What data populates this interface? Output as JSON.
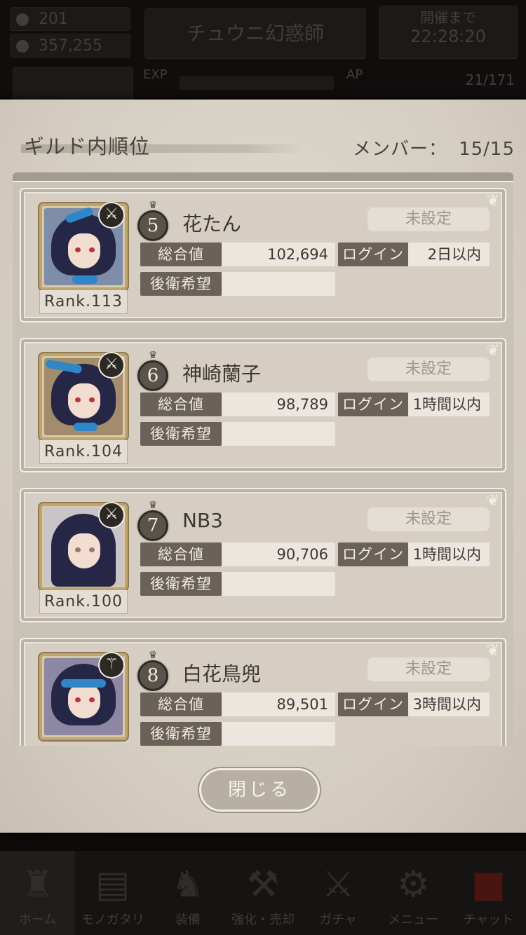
{
  "hud": {
    "stamina": "201",
    "gold": "357,255",
    "title": "チュウニ幻惑師",
    "timer_label": "開催まで",
    "timer_value": "22:28:20",
    "exp_label": "EXP",
    "ap_label": "AP",
    "ap_value": "21/171"
  },
  "panel": {
    "title": "ギルド内順位",
    "members_label": "メンバー：",
    "members_value": "15/15"
  },
  "labels": {
    "total": "総合値",
    "login": "ログイン",
    "backline": "後衛希望"
  },
  "members": [
    {
      "place": "5",
      "name": "花たん",
      "assignment": "未設定",
      "total": "102,694",
      "login": "2日以内",
      "rank": "Rank.113",
      "weapon_icon": "sword-icon"
    },
    {
      "place": "6",
      "name": "神崎蘭子",
      "assignment": "未設定",
      "total": "98,789",
      "login": "1時間以内",
      "rank": "Rank.104",
      "weapon_icon": "sword-icon"
    },
    {
      "place": "7",
      "name": "NB3",
      "assignment": "未設定",
      "total": "90,706",
      "login": "1時間以内",
      "rank": "Rank.100",
      "weapon_icon": "sword-icon"
    },
    {
      "place": "8",
      "name": "白花鳥兜",
      "assignment": "未設定",
      "total": "89,501",
      "login": "3時間以内",
      "rank": "",
      "weapon_icon": "staff-icon"
    }
  ],
  "close_button": "閉じる",
  "nav": [
    {
      "label": "ホーム",
      "icon": "castle-icon"
    },
    {
      "label": "モノガタリ",
      "icon": "book-icon"
    },
    {
      "label": "装備",
      "icon": "armor-icon"
    },
    {
      "label": "強化・売却",
      "icon": "hammer-icon"
    },
    {
      "label": "ガチャ",
      "icon": "crossed-swords-icon"
    },
    {
      "label": "メニュー",
      "icon": "gear-icon"
    },
    {
      "label": "チャット",
      "icon": "chat-alert-icon"
    }
  ]
}
